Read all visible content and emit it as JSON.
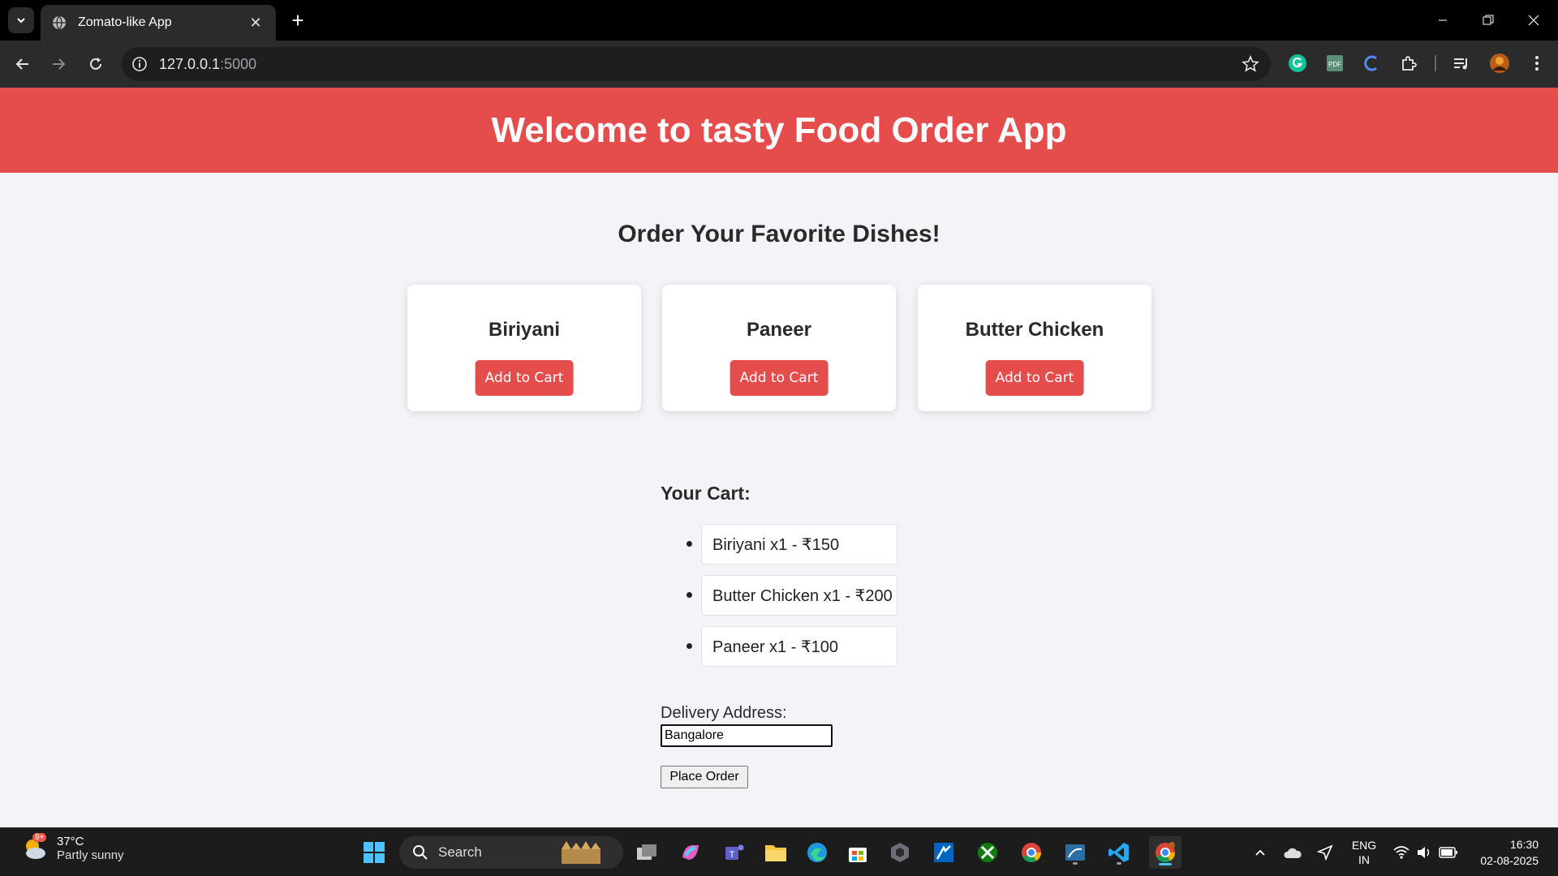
{
  "browser": {
    "tab_title": "Zomato-like App",
    "url_host": "127.0.0.1",
    "url_port": ":5000"
  },
  "page": {
    "header": "Welcome to tasty Food Order App",
    "section_title": "Order Your Favorite Dishes!",
    "dishes": [
      {
        "name": "Biriyani",
        "button": "Add to Cart"
      },
      {
        "name": "Paneer",
        "button": "Add to Cart"
      },
      {
        "name": "Butter Chicken",
        "button": "Add to Cart"
      }
    ],
    "cart_title": "Your Cart:",
    "cart_items": [
      "Biriyani x1 - ₹150",
      "Butter Chicken x1 - ₹200",
      "Paneer x1 - ₹100"
    ],
    "address_label": "Delivery Address:",
    "address_value": "Bangalore",
    "place_order": "Place Order"
  },
  "taskbar": {
    "weather_badge": "9+",
    "temperature": "37°C",
    "condition": "Partly sunny",
    "search_label": "Search",
    "language_top": "ENG",
    "language_bottom": "IN",
    "time": "16:30",
    "date": "02-08-2025"
  },
  "colors": {
    "accent": "#e54c4c",
    "page_bg": "#f4f4f8"
  }
}
